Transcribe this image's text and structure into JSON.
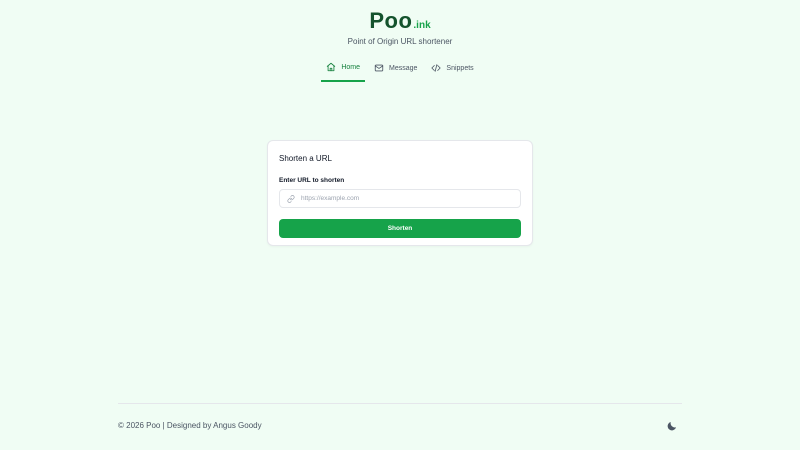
{
  "brand": {
    "logo_main": "Poo",
    "logo_suffix": ".ink",
    "tagline": "Point of Origin URL shortener",
    "accent_color": "#16a34a",
    "logo_color": "#14532d"
  },
  "nav": {
    "items": [
      {
        "label": "Home",
        "icon": "home-icon",
        "active": true
      },
      {
        "label": "Message",
        "icon": "mail-icon",
        "active": false
      },
      {
        "label": "Snippets",
        "icon": "code-icon",
        "active": false
      }
    ]
  },
  "form": {
    "title": "Shorten a URL",
    "field_label": "Enter URL to shorten",
    "placeholder": "https://example.com",
    "value": "",
    "field_icon": "link-icon",
    "submit_label": "Shorten"
  },
  "footer": {
    "text": "© 2026 Poo | Designed by Angus Goody",
    "theme_icon": "moon-icon"
  }
}
